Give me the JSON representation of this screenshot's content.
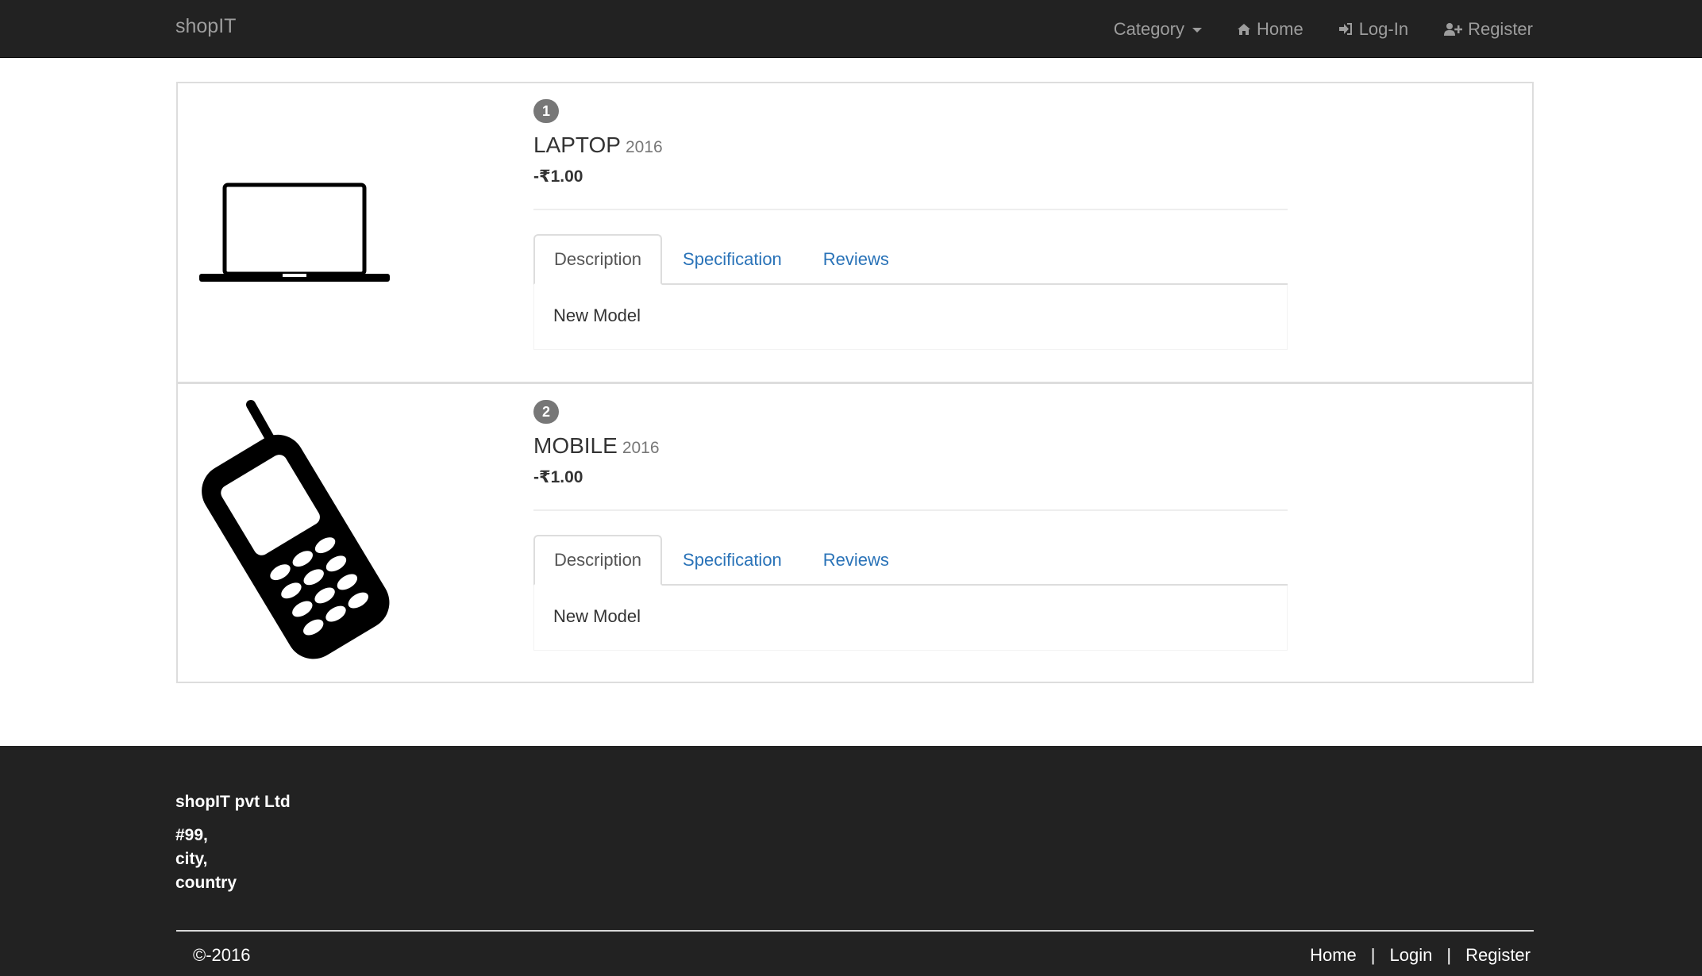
{
  "navbar": {
    "brand": "shopIT",
    "items": [
      {
        "label": "Category",
        "icon": "caret-down-icon"
      },
      {
        "label": "Home",
        "icon": "home-icon"
      },
      {
        "label": "Log-In",
        "icon": "login-icon"
      },
      {
        "label": "Register",
        "icon": "user-plus-icon"
      }
    ]
  },
  "products": [
    {
      "index": "1",
      "name": "LAPTOP",
      "year": "2016",
      "price": "-₹1.00",
      "image_icon": "laptop-icon",
      "tabs": [
        {
          "label": "Description"
        },
        {
          "label": "Specification"
        },
        {
          "label": "Reviews"
        }
      ],
      "active_tab": "Description",
      "description": "New Model"
    },
    {
      "index": "2",
      "name": "MOBILE",
      "year": "2016",
      "price": "-₹1.00",
      "image_icon": "mobile-phone-icon",
      "tabs": [
        {
          "label": "Description"
        },
        {
          "label": "Specification"
        },
        {
          "label": "Reviews"
        }
      ],
      "active_tab": "Description",
      "description": "New Model"
    }
  ],
  "footer": {
    "company": "shopIT pvt Ltd",
    "address": [
      "#99,",
      "city,",
      "country"
    ],
    "copyright": "©-2016",
    "links": [
      {
        "label": "Home"
      },
      {
        "label": "Login"
      },
      {
        "label": "Register"
      }
    ],
    "separator": "|"
  },
  "colors": {
    "navbar_bg": "#222222",
    "nav_text": "#9d9d9d",
    "link_blue": "#2a73b8",
    "badge_bg": "#777777",
    "border": "#dddddd"
  }
}
